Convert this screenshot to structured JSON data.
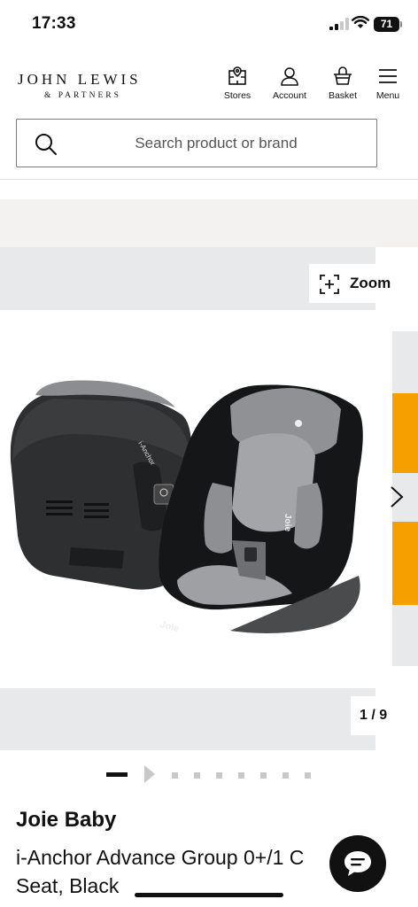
{
  "status_bar": {
    "time": "17:33",
    "battery": "71"
  },
  "header": {
    "logo_main": "JOHN LEWIS",
    "logo_sub": "& PARTNERS",
    "nav": [
      {
        "label": "Stores",
        "icon": "store-map-icon"
      },
      {
        "label": "Account",
        "icon": "account-icon"
      },
      {
        "label": "Basket",
        "icon": "basket-icon"
      },
      {
        "label": "Menu",
        "icon": "menu-icon"
      }
    ]
  },
  "search": {
    "placeholder": "Search product or brand",
    "value": ""
  },
  "gallery": {
    "zoom_label": "Zoom",
    "counter": "1 / 9",
    "current_image": 1,
    "total_images": 9,
    "image_logo_text": "Joie",
    "image_side_text": "i-Anchor",
    "thumbnail_accent": "#f5a000"
  },
  "product": {
    "brand": "Joie Baby",
    "title": "i-Anchor Advance Group 0+/1 C Seat, Black"
  },
  "colors": {
    "accent": "#f5a000",
    "text": "#111111",
    "panel": "#e7e9eb"
  }
}
